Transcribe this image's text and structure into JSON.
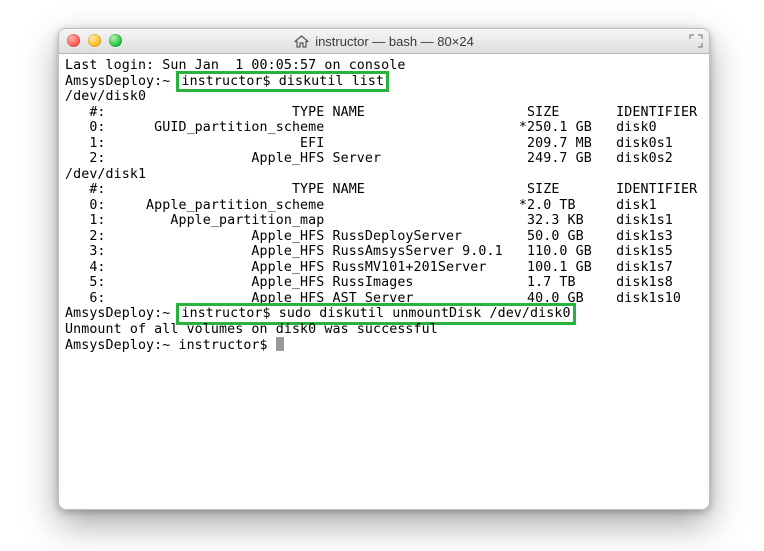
{
  "window": {
    "title": "instructor — bash — 80×24"
  },
  "colors": {
    "highlight_border": "#29b23e"
  },
  "lines": {
    "0": "Last login: Sun Jan  1 00:05:57 on console",
    "1a": "AmsysDeploy:~ ",
    "1b": "instructor$ diskutil list",
    "2": "/dev/disk0",
    "3": "   #:                       TYPE NAME                    SIZE       IDENTIFIER",
    "4": "   0:      GUID_partition_scheme                        *250.1 GB   disk0",
    "5": "   1:                        EFI                         209.7 MB   disk0s1",
    "6": "   2:                  Apple_HFS Server                  249.7 GB   disk0s2",
    "7": "/dev/disk1",
    "8": "   #:                       TYPE NAME                    SIZE       IDENTIFIER",
    "9": "   0:     Apple_partition_scheme                        *2.0 TB     disk1",
    "10": "   1:        Apple_partition_map                         32.3 KB    disk1s1",
    "11": "   2:                  Apple_HFS RussDeployServer        50.0 GB    disk1s3",
    "12": "   3:                  Apple_HFS RussAmsysServer 9.0.1   110.0 GB   disk1s5",
    "13": "   4:                  Apple_HFS RussMV101+201Server     100.1 GB   disk1s7",
    "14": "   5:                  Apple_HFS RussImages              1.7 TB     disk1s8",
    "15": "   6:                  Apple_HFS AST Server              40.0 GB    disk1s10",
    "16a": "AmsysDeploy:~ ",
    "16b": "instructor$ sudo diskutil unmountDisk /dev/disk0",
    "17": "Unmount of all volumes on disk0 was successful",
    "18": "AmsysDeploy:~ instructor$ "
  },
  "disks": [
    {
      "device": "/dev/disk0",
      "partitions": [
        {
          "num": "0",
          "type": "GUID_partition_scheme",
          "name": "",
          "size": "*250.1 GB",
          "identifier": "disk0"
        },
        {
          "num": "1",
          "type": "EFI",
          "name": "",
          "size": "209.7 MB",
          "identifier": "disk0s1"
        },
        {
          "num": "2",
          "type": "Apple_HFS",
          "name": "Server",
          "size": "249.7 GB",
          "identifier": "disk0s2"
        }
      ]
    },
    {
      "device": "/dev/disk1",
      "partitions": [
        {
          "num": "0",
          "type": "Apple_partition_scheme",
          "name": "",
          "size": "*2.0 TB",
          "identifier": "disk1"
        },
        {
          "num": "1",
          "type": "Apple_partition_map",
          "name": "",
          "size": "32.3 KB",
          "identifier": "disk1s1"
        },
        {
          "num": "2",
          "type": "Apple_HFS",
          "name": "RussDeployServer",
          "size": "50.0 GB",
          "identifier": "disk1s3"
        },
        {
          "num": "3",
          "type": "Apple_HFS",
          "name": "RussAmsysServer 9.0.1",
          "size": "110.0 GB",
          "identifier": "disk1s5"
        },
        {
          "num": "4",
          "type": "Apple_HFS",
          "name": "RussMV101+201Server",
          "size": "100.1 GB",
          "identifier": "disk1s7"
        },
        {
          "num": "5",
          "type": "Apple_HFS",
          "name": "RussImages",
          "size": "1.7 TB",
          "identifier": "disk1s8"
        },
        {
          "num": "6",
          "type": "Apple_HFS",
          "name": "AST Server",
          "size": "40.0 GB",
          "identifier": "disk1s10"
        }
      ]
    }
  ],
  "commands": [
    "diskutil list",
    "sudo diskutil unmountDisk /dev/disk0"
  ],
  "prompt": "AmsysDeploy:~ instructor$"
}
